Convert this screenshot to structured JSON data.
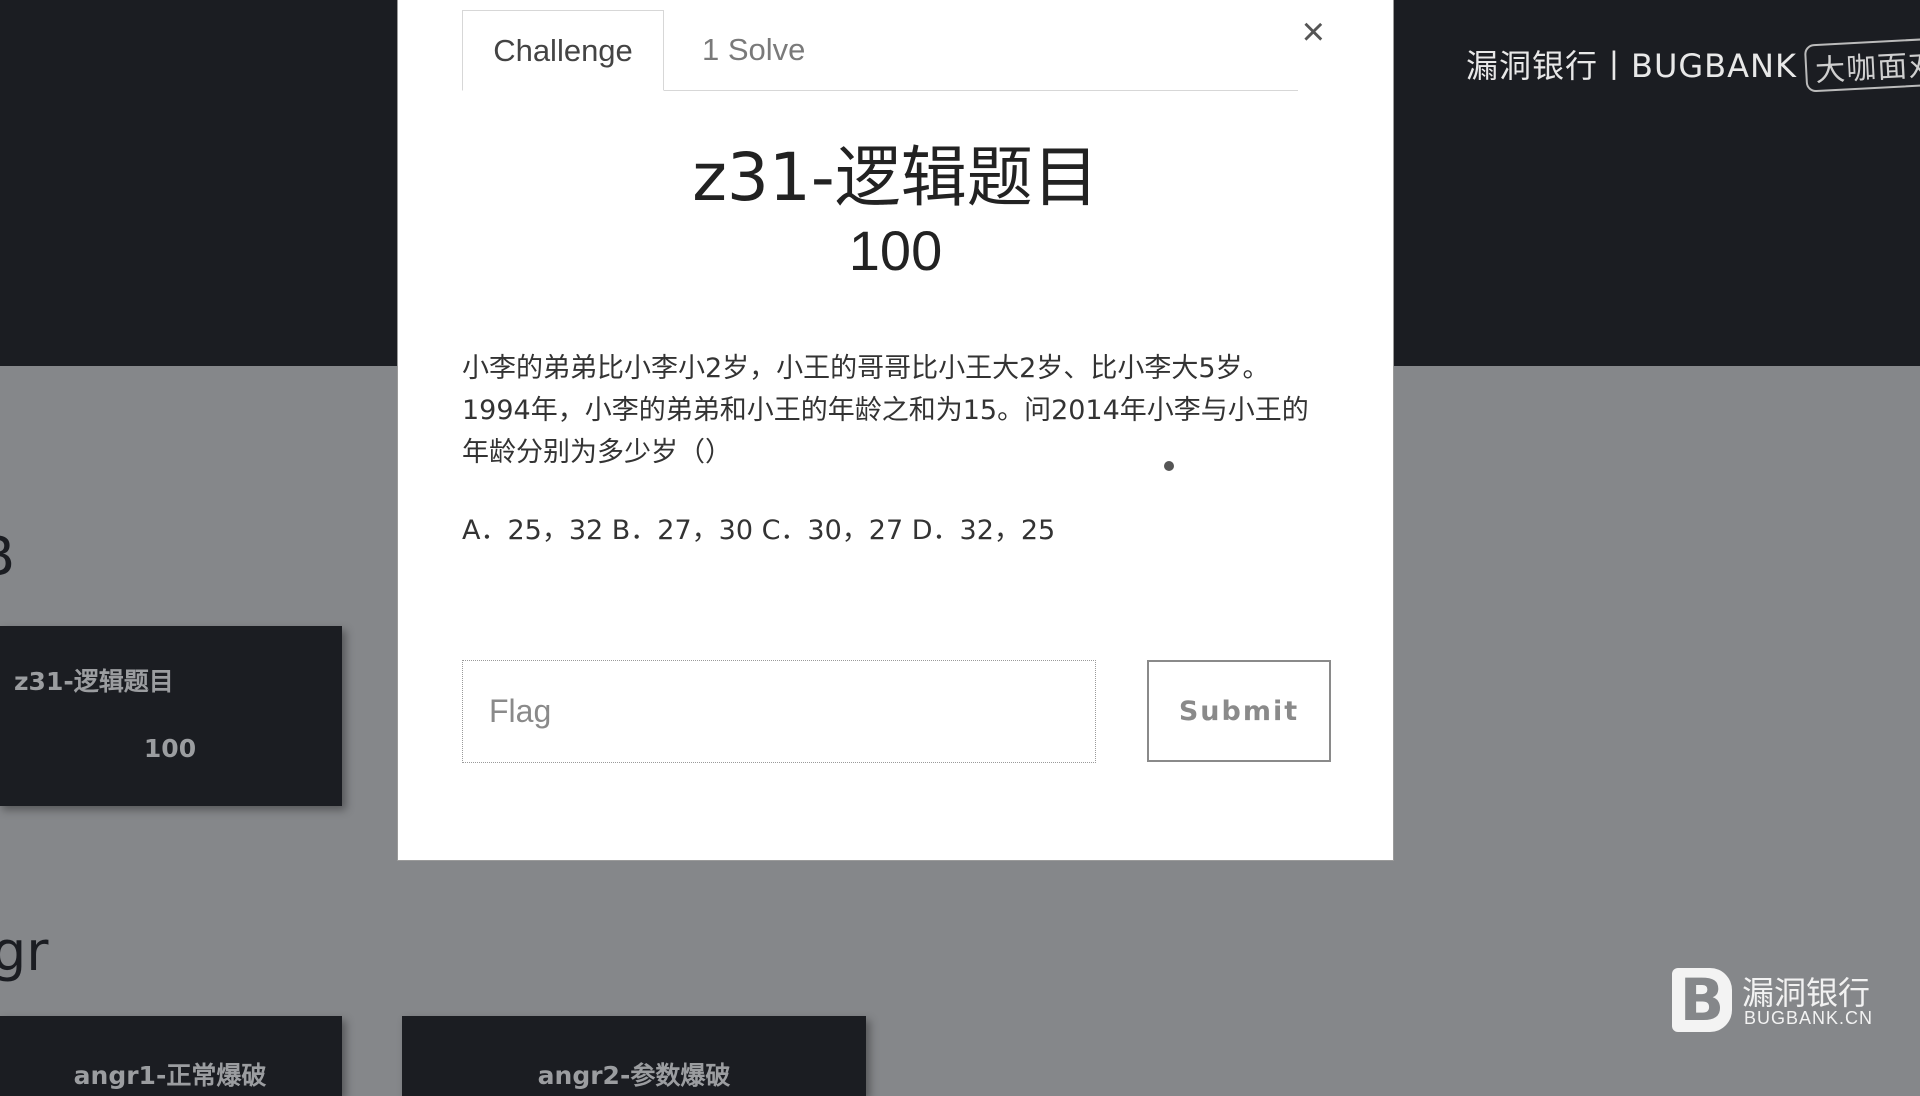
{
  "background": {
    "watermark": {
      "text": "漏洞银行丨BUGBANK",
      "tag": "大咖面对面"
    },
    "sections": [
      {
        "title_fragment": "B"
      },
      {
        "title_fragment": "gr"
      }
    ],
    "cards": [
      {
        "name": "z31-逻辑题目",
        "value": "100"
      },
      {
        "name": "angr1-正常爆破"
      },
      {
        "name": "angr2-参数爆破"
      }
    ],
    "brand_logo": {
      "mark": "B",
      "cn": "漏洞银行",
      "en": "BUGBANK.CN"
    }
  },
  "modal": {
    "tabs": [
      {
        "label": "Challenge",
        "active": true
      },
      {
        "label": "1 Solve",
        "active": false
      }
    ],
    "close_label": "×",
    "challenge": {
      "title": "z31-逻辑题目",
      "value": "100",
      "description": "小李的弟弟比小李小2岁，小王的哥哥比小王大2岁、比小李大5岁。1994年，小李的弟弟和小王的年龄之和为15。问2014年小李与小王的年龄分别为多少岁（）",
      "options": "A．25，32 B．27，30 C．30，27 D．32，25"
    },
    "flag_input": {
      "placeholder": "Flag",
      "value": ""
    },
    "submit_label": "Submit"
  }
}
